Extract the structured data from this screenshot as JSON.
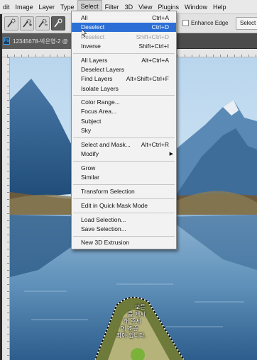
{
  "menubar": {
    "items": [
      "dit",
      "Image",
      "Layer",
      "Type",
      "Select",
      "Filter",
      "3D",
      "View",
      "Plugins",
      "Window",
      "Help"
    ],
    "active_index": 4
  },
  "options": {
    "enhance_edge": "Enhance Edge",
    "select_subject": "Select S"
  },
  "document": {
    "tab_title": "12345678-박은영-2 @",
    "icon": "Ps"
  },
  "canvas": {
    "subtitle_lines": [
      "모든",
      "를 제시",
      "해 주세",
      "에 조종",
      "좌야 합니다."
    ]
  },
  "select_menu": {
    "items": [
      {
        "label": "All",
        "shortcut": "Ctrl+A",
        "state": "normal"
      },
      {
        "label": "Deselect",
        "shortcut": "Ctrl+D",
        "state": "highlighted"
      },
      {
        "label": "Reselect",
        "shortcut": "Shift+Ctrl+D",
        "state": "disabled"
      },
      {
        "label": "Inverse",
        "shortcut": "Shift+Ctrl+I",
        "state": "normal"
      },
      {
        "label": "All Layers",
        "shortcut": "Alt+Ctrl+A",
        "state": "normal"
      },
      {
        "label": "Deselect Layers",
        "shortcut": "",
        "state": "normal"
      },
      {
        "label": "Find Layers",
        "shortcut": "Alt+Shift+Ctrl+F",
        "state": "normal"
      },
      {
        "label": "Isolate Layers",
        "shortcut": "",
        "state": "normal"
      },
      {
        "label": "Color Range...",
        "shortcut": "",
        "state": "normal"
      },
      {
        "label": "Focus Area...",
        "shortcut": "",
        "state": "normal"
      },
      {
        "label": "Subject",
        "shortcut": "",
        "state": "normal"
      },
      {
        "label": "Sky",
        "shortcut": "",
        "state": "normal"
      },
      {
        "label": "Select and Mask...",
        "shortcut": "Alt+Ctrl+R",
        "state": "normal"
      },
      {
        "label": "Modify",
        "shortcut": "",
        "state": "submenu"
      },
      {
        "label": "Grow",
        "shortcut": "",
        "state": "normal"
      },
      {
        "label": "Similar",
        "shortcut": "",
        "state": "normal"
      },
      {
        "label": "Transform Selection",
        "shortcut": "",
        "state": "normal"
      },
      {
        "label": "Edit in Quick Mask Mode",
        "shortcut": "",
        "state": "normal"
      },
      {
        "label": "Load Selection...",
        "shortcut": "",
        "state": "normal"
      },
      {
        "label": "Save Selection...",
        "shortcut": "",
        "state": "normal"
      },
      {
        "label": "New 3D Extrusion",
        "shortcut": "",
        "state": "normal"
      }
    ],
    "submenu_arrow": "▶"
  }
}
